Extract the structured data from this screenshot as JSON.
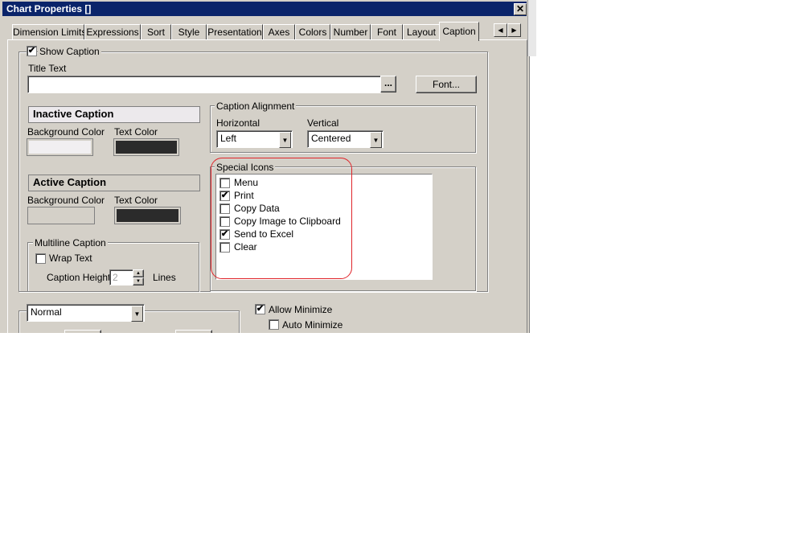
{
  "window": {
    "title": "Chart Properties []",
    "close_glyph": "✕"
  },
  "tabs": [
    {
      "label": "Dimension Limits"
    },
    {
      "label": "Expressions"
    },
    {
      "label": "Sort"
    },
    {
      "label": "Style"
    },
    {
      "label": "Presentation"
    },
    {
      "label": "Axes"
    },
    {
      "label": "Colors"
    },
    {
      "label": "Number"
    },
    {
      "label": "Font"
    },
    {
      "label": "Layout"
    },
    {
      "label": "Caption",
      "active": true
    }
  ],
  "tab_scroll": {
    "left": "◀",
    "right": "▶"
  },
  "caption": {
    "show_caption_label": "Show Caption",
    "show_caption_checked": true,
    "title_text_label": "Title Text",
    "title_text_value": "",
    "browse_label": "...",
    "font_button": "Font..."
  },
  "inactive_caption": {
    "header": "Inactive Caption",
    "bg_label": "Background Color",
    "text_label": "Text Color",
    "bg_color": "#f1eff1",
    "text_color": "#2b2b2b"
  },
  "active_caption": {
    "header": "Active Caption",
    "bg_label": "Background Color",
    "text_label": "Text Color",
    "bg_color": "#d4d0c8",
    "text_color": "#2b2b2b"
  },
  "multiline": {
    "group_label": "Multiline Caption",
    "wrap_label": "Wrap Text",
    "wrap_checked": false,
    "height_label": "Caption Height",
    "height_value": "2",
    "lines_label": "Lines"
  },
  "alignment": {
    "group_label": "Caption Alignment",
    "horizontal_label": "Horizontal",
    "horizontal_value": "Left",
    "vertical_label": "Vertical",
    "vertical_value": "Centered"
  },
  "special_icons": {
    "group_label": "Special Icons",
    "items": [
      {
        "label": "Menu",
        "checked": false
      },
      {
        "label": "Print",
        "checked": true
      },
      {
        "label": "Copy Data",
        "checked": false
      },
      {
        "label": "Copy Image to Clipboard",
        "checked": false
      },
      {
        "label": "Send to Excel",
        "checked": true
      },
      {
        "label": "Clear",
        "checked": false
      }
    ],
    "highlight_color": "#e0242a"
  },
  "bottom": {
    "mode_value": "Normal",
    "allow_minimize_label": "Allow Minimize",
    "allow_minimize_checked": true,
    "auto_minimize_label": "Auto Minimize",
    "auto_minimize_checked": false
  },
  "check_glyph": "✔",
  "dropdown_glyph": "▼",
  "colors": {
    "title_bar": "#0a246a",
    "dialog_face": "#d4d0c8"
  }
}
